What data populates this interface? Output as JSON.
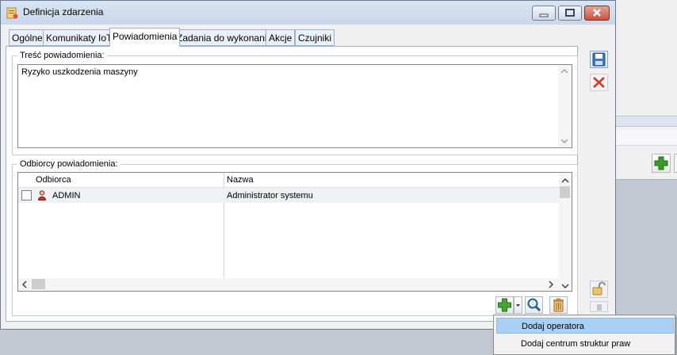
{
  "window": {
    "title": "Definicja zdarzenia"
  },
  "tabs": [
    {
      "label": "Ogólne"
    },
    {
      "label": "Komunikaty IoT"
    },
    {
      "label": "Powiadomienia"
    },
    {
      "label": "Zadania do wykonania"
    },
    {
      "label": "Akcje"
    },
    {
      "label": "Czujniki"
    }
  ],
  "active_tab": "Powiadomienia",
  "content": {
    "label": "Treść powiadomienia:",
    "value": "Ryzyko uszkodzenia maszyny"
  },
  "recipients": {
    "label": "Odbiorcy powiadomienia:",
    "columns": [
      "Odbiorca",
      "Nazwa"
    ],
    "rows": [
      {
        "recipient": "ADMIN",
        "name": "Administrator systemu",
        "icon": "user-icon"
      }
    ]
  },
  "context_menu": {
    "items": [
      {
        "label": "Dodaj operatora",
        "highlighted": true
      },
      {
        "label": "Dodaj centrum struktur praw",
        "highlighted": false
      }
    ]
  },
  "colors": {
    "title_bg": "#c9d7ea",
    "tab_border": "#9fb1c9",
    "menu_highlight": "#a8d0f2",
    "plus_green": "#3c9a2c",
    "delete_red": "#d23a2a"
  }
}
